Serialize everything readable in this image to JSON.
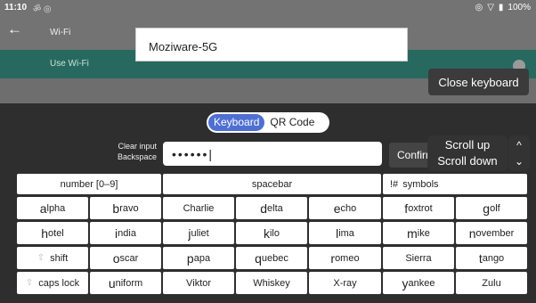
{
  "status_bar": {
    "time": "11:10",
    "icons_left": "ॐ ◎",
    "battery": "100%"
  },
  "app_bar": {
    "title": "Wi-Fi"
  },
  "use_wifi": {
    "label": "Use Wi-Fi"
  },
  "ssid_input": {
    "value": "Moziware-5G"
  },
  "close_keyboard": {
    "label": "Close keyboard"
  },
  "mode_toggle": {
    "keyboard": "Keyboard",
    "qr": "QR Code"
  },
  "aux": {
    "clear": "Clear input",
    "backspace": "Backspace"
  },
  "password_input": {
    "value": "••••••|"
  },
  "confirm": {
    "label": "Confirm"
  },
  "scroll": {
    "up": "Scroll up",
    "down": "Scroll down"
  },
  "keys": {
    "number": "number [0–9]",
    "spacebar": "spacebar",
    "symbols": "symbols",
    "symbols_prefix": "!#",
    "alpha_first": "a",
    "alpha_rest": "lpha",
    "bravo_first": "b",
    "bravo_rest": "ravo",
    "charlie_first": "C",
    "charlie_rest": "harlie",
    "delta_first": "d",
    "delta_rest": "elta",
    "echo_first": "e",
    "echo_rest": "cho",
    "foxtrot_first": "f",
    "foxtrot_rest": "oxtrot",
    "golf_first": "g",
    "golf_rest": "olf",
    "hotel_first": "h",
    "hotel_rest": "otel",
    "india_first": "i",
    "india_rest": "ndia",
    "juliet_first": "j",
    "juliet_rest": "uliet",
    "kilo_first": "k",
    "kilo_rest": "ilo",
    "lima_first": "l",
    "lima_rest": "ima",
    "mike_first": "m",
    "mike_rest": "ike",
    "november_first": "n",
    "november_rest": "ovember",
    "shift": "shift",
    "oscar_first": "o",
    "oscar_rest": "scar",
    "papa_first": "p",
    "papa_rest": "apa",
    "quebec_first": "q",
    "quebec_rest": "uebec",
    "romeo_first": "r",
    "romeo_rest": "omeo",
    "sierra_first": "S",
    "sierra_rest": "ierra",
    "tango_first": "t",
    "tango_rest": "ango",
    "capslock": "caps lock",
    "uniform_first": "u",
    "uniform_rest": "niform",
    "viktor_first": "V",
    "viktor_rest": "iktor",
    "whiskey_first": "W",
    "whiskey_rest": "hiskey",
    "xray_first": "X",
    "xray_rest": "-ray",
    "yankee_first": "y",
    "yankee_rest": "ankee",
    "zulu_first": "Z",
    "zulu_rest": "ulu"
  }
}
